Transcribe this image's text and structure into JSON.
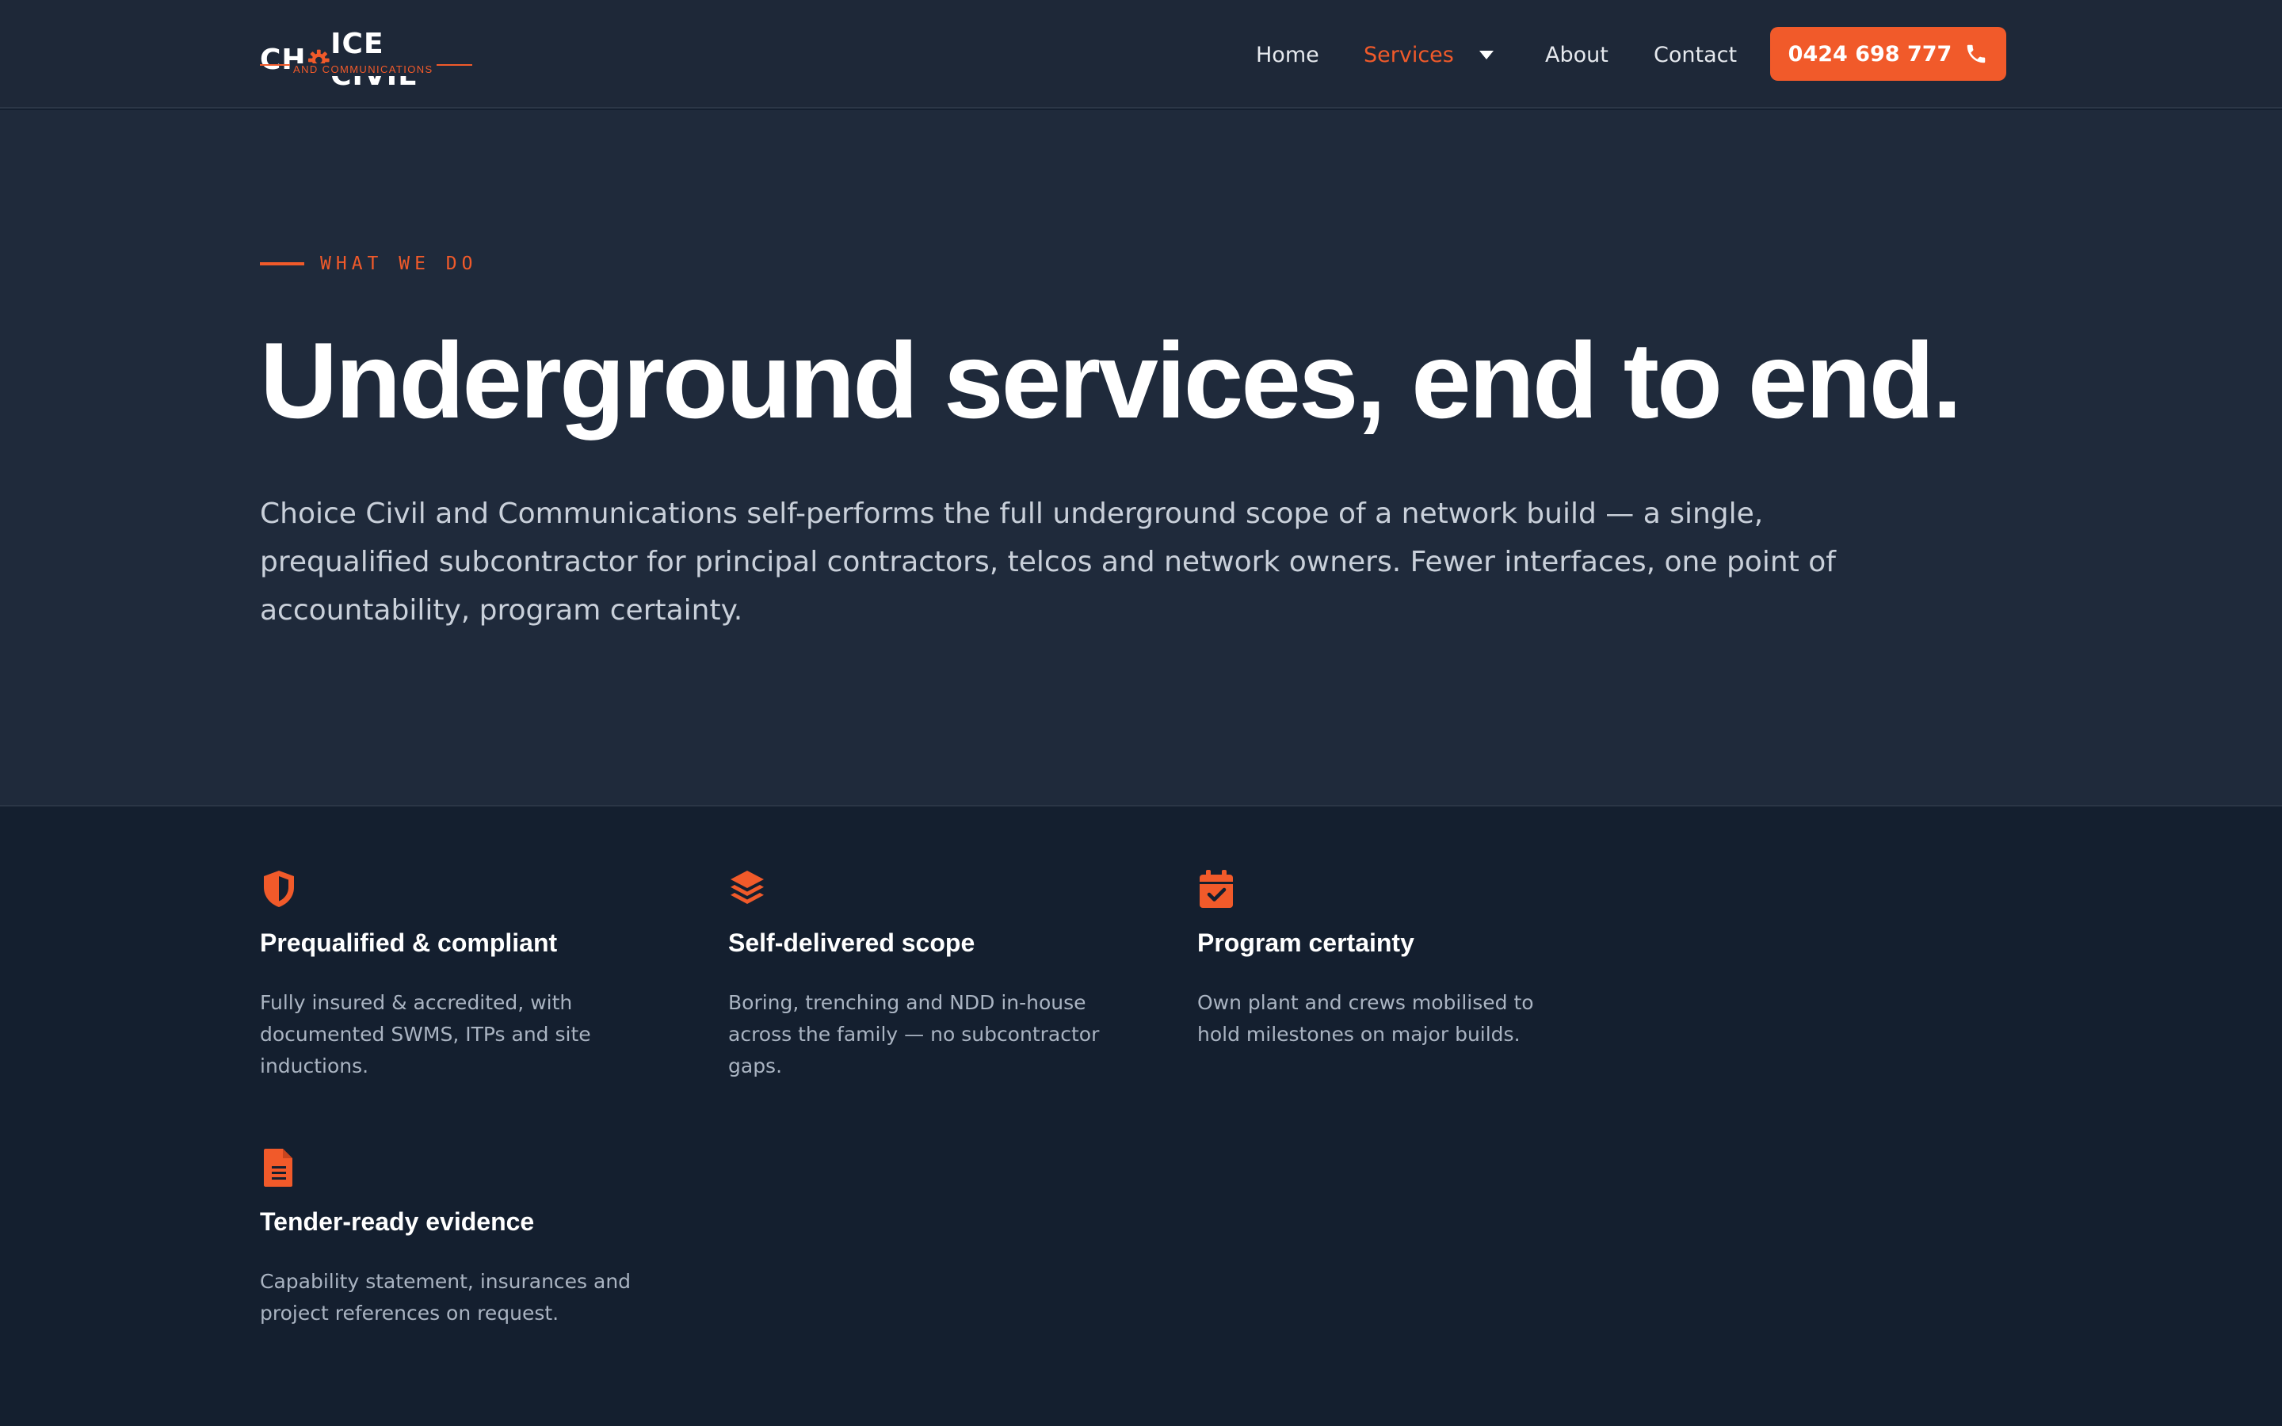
{
  "brand": {
    "logo_main_left": "CH",
    "logo_main_right": "ICE CIVIL",
    "logo_sub": "AND COMMUNICATIONS",
    "accent_color": "#f15a2a",
    "header_bg": "#1e2838"
  },
  "nav": {
    "items": [
      {
        "label": "Home",
        "active": false
      },
      {
        "label": "Services",
        "active": true,
        "has_dropdown": true
      },
      {
        "label": "About",
        "active": false
      },
      {
        "label": "Contact",
        "active": false
      }
    ],
    "dropdown_icon": "caret-down-icon"
  },
  "cta": {
    "phone_label": "0424 698 777",
    "icon": "phone-icon"
  },
  "hero": {
    "eyebrow": "WHAT WE DO",
    "title": "Underground services, end to end.",
    "lede": "Choice Civil and Communications self-performs the full underground scope of a network build — a single, prequalified subcontractor for principal contractors, telcos and network owners. Fewer interfaces, one point of accountability, program certainty."
  },
  "features": [
    {
      "icon": "shield-icon",
      "title": "Prequalified & compliant",
      "description": "Fully insured & accredited, with documented SWMS, ITPs and site inductions."
    },
    {
      "icon": "layers-icon",
      "title": "Self-delivered scope",
      "description": "Boring, trenching and NDD in-house across the family — no subcontractor gaps."
    },
    {
      "icon": "calendar-check-icon",
      "title": "Program certainty",
      "description": "Own plant and crews mobilised to hold milestones on major builds."
    },
    {
      "icon": "document-icon",
      "title": "Tender-ready evidence",
      "description": "Capability statement, insurances and project references on request."
    }
  ]
}
